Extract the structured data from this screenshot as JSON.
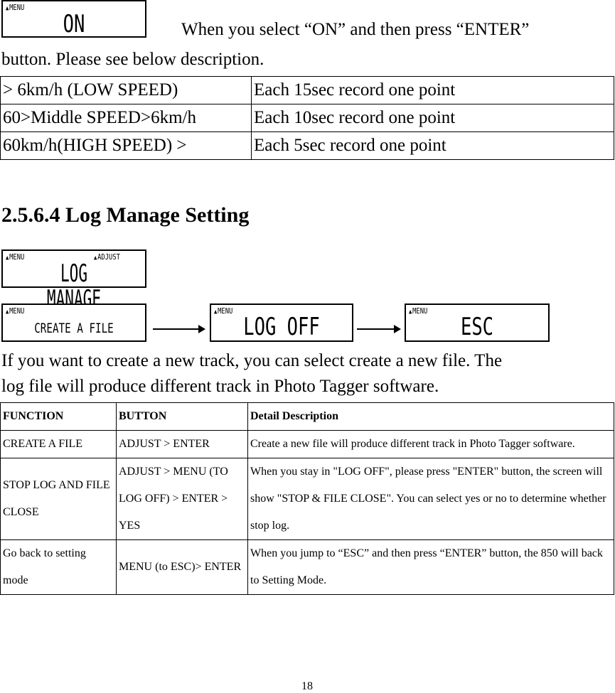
{
  "lcd_on": {
    "tag": "MENU",
    "text": "ON"
  },
  "intro": {
    "line1": "When you select “ON” and then press “ENTER”",
    "line2": "button. Please see below description."
  },
  "speed_table": [
    [
      "> 6km/h (LOW SPEED)",
      "Each 15sec record one point"
    ],
    [
      "60>Middle SPEED>6km/h",
      "Each 10sec record one point"
    ],
    [
      "60km/h(HIGH SPEED) >",
      "Each 5sec record one point"
    ]
  ],
  "heading": "2.5.6.4 Log Manage Setting",
  "lcd_log_manage": {
    "tag_left": "MENU",
    "tag_right": "ADJUST",
    "text": "LOG MANAGE"
  },
  "lcd_create": {
    "tag": "MENU",
    "text": "CREATE A FILE"
  },
  "lcd_log_off": {
    "tag": "MENU",
    "text": "LOG OFF"
  },
  "lcd_esc": {
    "tag": "MENU",
    "text": "ESC"
  },
  "paragraph": {
    "line1": "If you want to create a new track, you can select create a new file. The",
    "line2": "log file will produce different track in Photo Tagger software."
  },
  "func_table": {
    "headers": [
      "FUNCTION",
      "BUTTON",
      "Detail Description"
    ],
    "rows": [
      [
        "CREATE A FILE",
        "ADJUST > ENTER",
        "Create a new file will produce different track in Photo Tagger software."
      ],
      [
        "STOP LOG AND FILE CLOSE",
        "ADJUST > MENU (TO LOG OFF) > ENTER > YES",
        "When you stay in \"LOG OFF\", please press \"ENTER\" button, the screen will show \"STOP & FILE CLOSE\". You can select yes or no to determine whether stop log."
      ],
      [
        "Go back to setting mode",
        "MENU (to ESC)> ENTER",
        "When you jump to “ESC” and then press “ENTER” button, the 850 will back to Setting Mode."
      ]
    ]
  },
  "page_number": "18"
}
